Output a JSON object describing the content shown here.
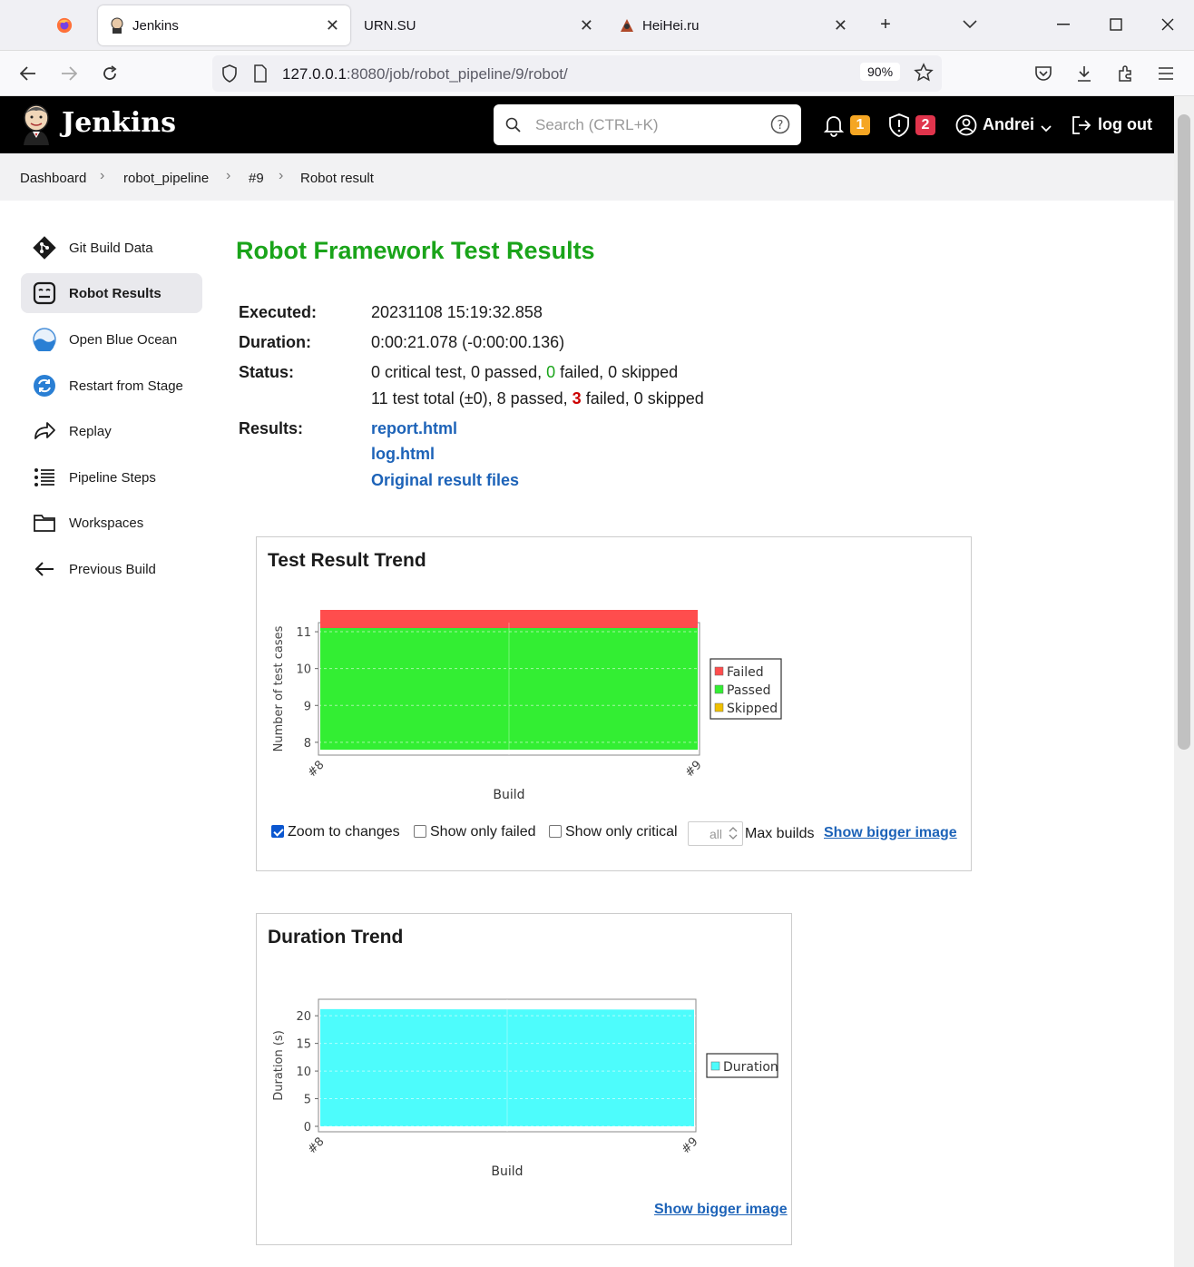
{
  "browser": {
    "tabs": [
      {
        "label": "",
        "icon": "firefox-icon"
      },
      {
        "label": "Jenkins",
        "icon": "jenkins-icon",
        "active": true
      },
      {
        "label": "URN.SU",
        "icon": ""
      },
      {
        "label": "HeiHei.ru",
        "icon": "heihei-icon"
      }
    ],
    "url_host": "127.0.0.1",
    "url_rest": ":8080/job/robot_pipeline/9/robot/",
    "zoom": "90%"
  },
  "header": {
    "brand": "Jenkins",
    "search_placeholder": "Search (CTRL+K)",
    "notifications_count": "1",
    "security_count": "2",
    "user": "Andrei",
    "logout": "log out"
  },
  "breadcrumb": [
    "Dashboard",
    "robot_pipeline",
    "#9",
    "Robot result"
  ],
  "sidebar": {
    "items": [
      {
        "label": "Git Build Data",
        "icon": "git-icon"
      },
      {
        "label": "Robot Results",
        "icon": "robot-icon",
        "selected": true
      },
      {
        "label": "Open Blue Ocean",
        "icon": "blue-ocean-icon"
      },
      {
        "label": "Restart from Stage",
        "icon": "restart-icon"
      },
      {
        "label": "Replay",
        "icon": "replay-icon"
      },
      {
        "label": "Pipeline Steps",
        "icon": "pipeline-steps-icon"
      },
      {
        "label": "Workspaces",
        "icon": "folder-icon"
      },
      {
        "label": "Previous Build",
        "icon": "arrow-left-icon"
      }
    ]
  },
  "main": {
    "title": "Robot Framework Test Results",
    "executed_label": "Executed:",
    "executed": "20231108 15:19:32.858",
    "duration_label": "Duration:",
    "duration": "0:00:21.078 (-0:00:00.136)",
    "status_label": "Status:",
    "status_line1": {
      "a": "0 critical test, 0 passed, ",
      "b": "0",
      "c": " failed, 0 skipped"
    },
    "status_line2": {
      "a": "11 test total (±0), 8 passed, ",
      "b": "3",
      "c": " failed, 0 skipped"
    },
    "results_label": "Results:",
    "links": [
      "report.html",
      "log.html",
      "Original result files"
    ]
  },
  "trend": {
    "title": "Test Result Trend",
    "zoom_label": "Zoom to changes",
    "only_failed_label": "Show only failed",
    "only_critical_label": "Show only critical",
    "max_builds_value": "all",
    "max_builds_label": "Max builds",
    "bigger": "Show bigger image"
  },
  "duration_card": {
    "title": "Duration Trend",
    "bigger": "Show bigger image"
  },
  "chart_data": [
    {
      "type": "area",
      "x": [
        "#8",
        "#9"
      ],
      "series": [
        {
          "name": "Skipped",
          "values": [
            0,
            0
          ],
          "color": "#f0c000"
        },
        {
          "name": "Passed",
          "values": [
            8,
            8
          ],
          "color": "#33ee33"
        },
        {
          "name": "Failed",
          "values": [
            3,
            3
          ],
          "color": "#ff4d4d"
        }
      ],
      "stacked": true,
      "xlabel": "Build",
      "ylabel": "Number of test cases",
      "ylim": [
        7.8,
        11.1
      ],
      "yticks": [
        8,
        9,
        10,
        11
      ],
      "legend": "right"
    },
    {
      "type": "area",
      "x": [
        "#8",
        "#9"
      ],
      "series": [
        {
          "name": "Duration",
          "values": [
            21.2,
            21.1
          ],
          "color": "#4dfcfc"
        }
      ],
      "xlabel": "Build",
      "ylabel": "Duration (s)",
      "ylim": [
        0,
        22
      ],
      "yticks": [
        0,
        5,
        10,
        15,
        20
      ],
      "legend": "right"
    }
  ]
}
